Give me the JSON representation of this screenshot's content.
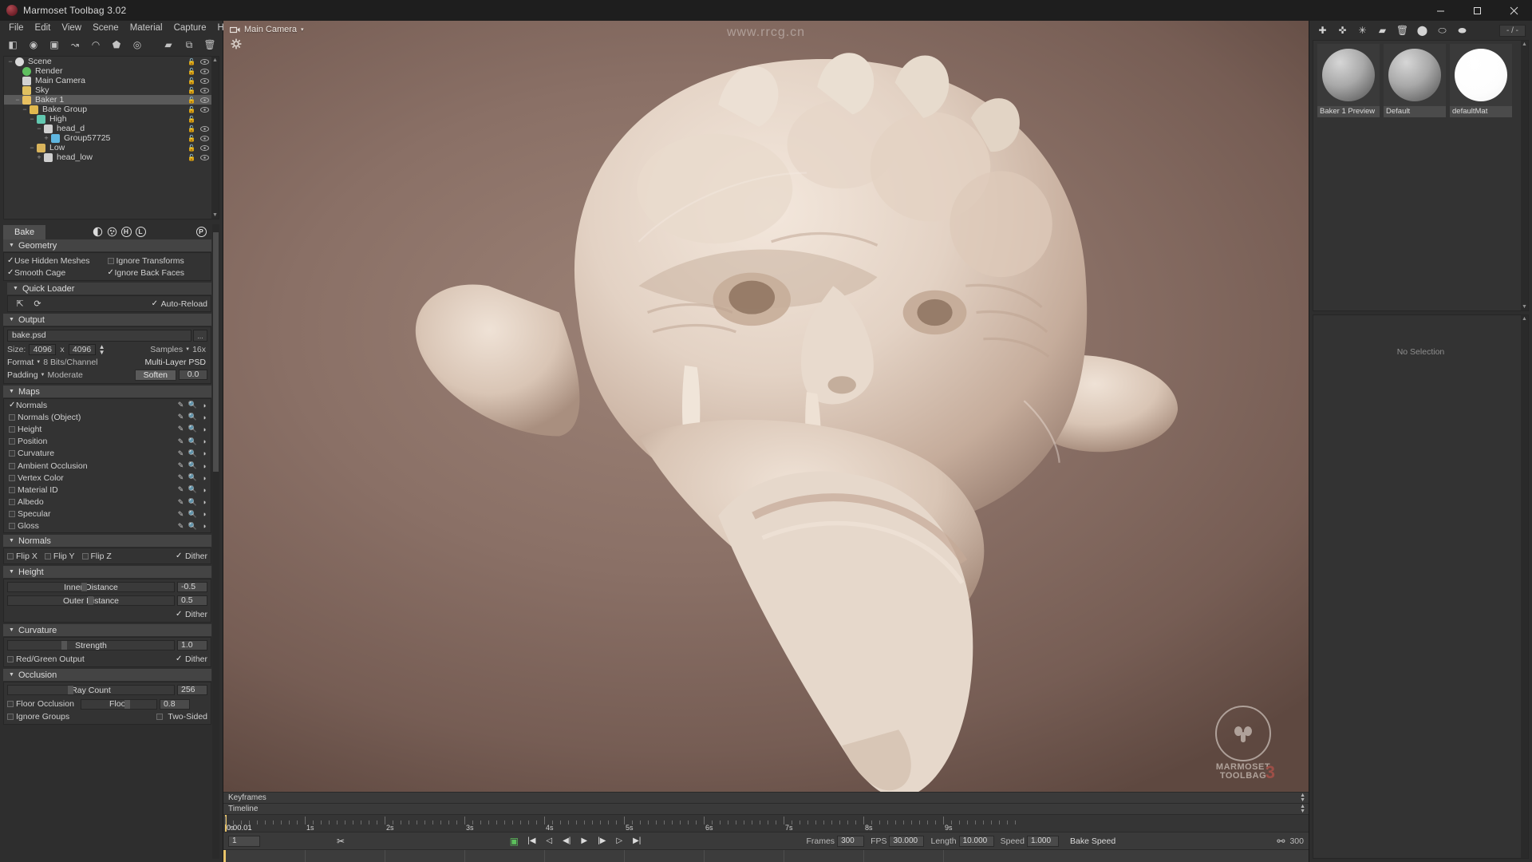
{
  "window": {
    "title": "Marmoset Toolbag 3.02",
    "app_icon": "marmoset-logo-icon",
    "controls": {
      "minimize": "minimize-icon",
      "maximize": "maximize-icon",
      "close": "close-icon"
    }
  },
  "menubar": {
    "items": [
      "File",
      "Edit",
      "View",
      "Scene",
      "Material",
      "Capture",
      "Help"
    ]
  },
  "left_toolbar": {
    "buttons": [
      {
        "name": "add-mesh-icon",
        "glyph": "◧"
      },
      {
        "name": "add-light-icon",
        "glyph": "◉"
      },
      {
        "name": "add-camera-icon",
        "glyph": "▣"
      },
      {
        "name": "add-turntable-icon",
        "glyph": "↝"
      },
      {
        "name": "add-sky-icon",
        "glyph": "◠"
      },
      {
        "name": "add-baker-icon",
        "glyph": "⬟"
      },
      {
        "name": "add-fog-icon",
        "glyph": "◎"
      },
      {
        "name": "folder-icon",
        "glyph": "▰"
      },
      {
        "name": "duplicate-icon",
        "glyph": "⧉"
      },
      {
        "name": "delete-icon",
        "glyph": "🗑"
      }
    ]
  },
  "scene_tree": {
    "nodes": [
      {
        "label": "Scene",
        "depth": 0,
        "icon": "scene-icon",
        "expander": "−",
        "lock": true,
        "eye": true,
        "selected": false
      },
      {
        "label": "Render",
        "depth": 1,
        "icon": "render-icon",
        "expander": "",
        "lock": true,
        "eye": true,
        "selected": false
      },
      {
        "label": "Main Camera",
        "depth": 1,
        "icon": "camera-icon",
        "expander": "",
        "lock": true,
        "eye": true,
        "selected": false
      },
      {
        "label": "Sky",
        "depth": 1,
        "icon": "sky-icon",
        "expander": "",
        "lock": true,
        "eye": true,
        "selected": false
      },
      {
        "label": "Baker 1",
        "depth": 1,
        "icon": "baker-icon",
        "expander": "−",
        "lock": true,
        "eye": true,
        "selected": true
      },
      {
        "label": "Bake Group",
        "depth": 2,
        "icon": "folder-icon",
        "expander": "−",
        "lock": true,
        "eye": true,
        "selected": false
      },
      {
        "label": "High",
        "depth": 3,
        "icon": "high-icon",
        "expander": "−",
        "lock": true,
        "eye": false,
        "selected": false
      },
      {
        "label": "head_d",
        "depth": 4,
        "icon": "mesh-icon",
        "expander": "−",
        "lock": true,
        "eye": true,
        "selected": false
      },
      {
        "label": "Group57725",
        "depth": 5,
        "icon": "group-icon",
        "expander": "+",
        "lock": true,
        "eye": true,
        "selected": false
      },
      {
        "label": "Low",
        "depth": 3,
        "icon": "low-icon",
        "expander": "−",
        "lock": true,
        "eye": true,
        "selected": false
      },
      {
        "label": "head_low",
        "depth": 4,
        "icon": "mesh-icon",
        "expander": "+",
        "lock": true,
        "eye": true,
        "selected": false
      }
    ]
  },
  "bake_panel": {
    "tab_label": "Bake",
    "header_buttons": [
      {
        "name": "bake-preview-toggle-icon",
        "glyph": "◐"
      },
      {
        "name": "bake-samples-icon",
        "glyph": "✸"
      },
      {
        "name": "high-poly-toggle",
        "glyph": "H"
      },
      {
        "name": "low-poly-toggle",
        "glyph": "L"
      },
      {
        "name": "preview-toggle",
        "glyph": "P"
      }
    ],
    "geometry": {
      "title": "Geometry",
      "options": [
        {
          "label": "Use Hidden Meshes",
          "checked": true
        },
        {
          "label": "Ignore Transforms",
          "checked": false
        },
        {
          "label": "Smooth Cage",
          "checked": true
        },
        {
          "label": "Ignore Back Faces",
          "checked": true
        }
      ]
    },
    "quick_loader": {
      "title": "Quick Loader",
      "load_icon": "load-files-icon",
      "reload_icon": "reload-icon",
      "auto_reload": {
        "label": "Auto-Reload",
        "checked": true
      }
    },
    "output": {
      "title": "Output",
      "filename": "bake.psd",
      "browse_label": "...",
      "size_label": "Size:",
      "width": "4096",
      "x_label": "x",
      "height": "4096",
      "samples_label": "Samples",
      "samples_value": "16x",
      "format_label": "Format",
      "format_value": "8 Bits/Channel",
      "multi_layer_label": "Multi-Layer PSD",
      "padding_label": "Padding",
      "padding_value": "Moderate",
      "soften_label": "Soften",
      "soften_value": "0.0"
    },
    "maps": {
      "title": "Maps",
      "items": [
        {
          "label": "Normals",
          "checked": true
        },
        {
          "label": "Normals (Object)",
          "checked": false
        },
        {
          "label": "Height",
          "checked": false
        },
        {
          "label": "Position",
          "checked": false
        },
        {
          "label": "Curvature",
          "checked": false
        },
        {
          "label": "Ambient Occlusion",
          "checked": false
        },
        {
          "label": "Vertex Color",
          "checked": false
        },
        {
          "label": "Material ID",
          "checked": false
        },
        {
          "label": "Albedo",
          "checked": false
        },
        {
          "label": "Specular",
          "checked": false
        },
        {
          "label": "Gloss",
          "checked": false
        }
      ],
      "row_icons": [
        "edit-pencil-icon",
        "preview-magnifier-icon",
        "material-sphere-icon"
      ]
    },
    "normals": {
      "title": "Normals",
      "flip_x": {
        "label": "Flip X",
        "checked": false
      },
      "flip_y": {
        "label": "Flip Y",
        "checked": false
      },
      "flip_z": {
        "label": "Flip Z",
        "checked": false
      },
      "dither": {
        "label": "Dither",
        "checked": true
      }
    },
    "height": {
      "title": "Height",
      "inner_distance_label": "Inner Distance",
      "inner_distance_value": "-0.5",
      "outer_distance_label": "Outer Distance",
      "outer_distance_value": "0.5",
      "dither": {
        "label": "Dither",
        "checked": true
      }
    },
    "curvature": {
      "title": "Curvature",
      "strength_label": "Strength",
      "strength_value": "1.0",
      "red_green_output": {
        "label": "Red/Green Output",
        "checked": false
      },
      "dither": {
        "label": "Dither",
        "checked": true
      }
    },
    "occlusion": {
      "title": "Occlusion",
      "ray_count_label": "Ray Count",
      "ray_count_value": "256",
      "floor_occlusion": {
        "label": "Floor Occlusion",
        "checked": false
      },
      "floor_label": "Floor",
      "floor_value": "0.8",
      "ignore_groups": {
        "label": "Ignore Groups",
        "checked": false
      },
      "two_sided": {
        "label": "Two-Sided",
        "checked": false
      }
    }
  },
  "viewport": {
    "camera_label": "Main Camera",
    "camera_icon": "camera-icon",
    "camera_caret": "▾",
    "settings_icon": "gear-icon",
    "watermark": "www.rrcg.cn",
    "logo": {
      "line1": "MARMOSET",
      "line2": "TOOLBAG",
      "version": "3"
    }
  },
  "timeline": {
    "keyframes_label": "Keyframes",
    "timeline_label": "Timeline",
    "timecode": "0:00.01",
    "frame_field": "1",
    "ruler_labels": [
      "0s",
      "1s",
      "2s",
      "3s",
      "4s",
      "5s",
      "6s",
      "7s",
      "8s",
      "9s"
    ],
    "scissors_icon": "cut-keyframe-icon",
    "transport": [
      {
        "name": "record-button",
        "glyph": "▣"
      },
      {
        "name": "jump-start-button",
        "glyph": "|◀"
      },
      {
        "name": "prev-keyframe-button",
        "glyph": "◁"
      },
      {
        "name": "step-back-button",
        "glyph": "◀|"
      },
      {
        "name": "play-button",
        "glyph": "▶"
      },
      {
        "name": "step-forward-button",
        "glyph": "|▶"
      },
      {
        "name": "next-keyframe-button",
        "glyph": "▷"
      },
      {
        "name": "jump-end-button",
        "glyph": "▶|"
      }
    ],
    "frames_label": "Frames",
    "frames_value": "300",
    "fps_label": "FPS",
    "fps_value": "30.000",
    "length_label": "Length",
    "length_value": "10.000",
    "speed_label": "Speed",
    "speed_value": "1.000",
    "bake_speed_label": "Bake Speed",
    "link_icon": "link-icon",
    "end_frame_value": "300"
  },
  "right_panel": {
    "toolbar": [
      {
        "name": "add-material-icon",
        "glyph": "✚"
      },
      {
        "name": "duplicate-material-icon",
        "glyph": "✜"
      },
      {
        "name": "clear-material-icon",
        "glyph": "✳"
      },
      {
        "name": "folder-icon",
        "glyph": "▰"
      },
      {
        "name": "delete-material-icon",
        "glyph": "🗑"
      },
      {
        "name": "assign-material-icon",
        "glyph": "⬤"
      },
      {
        "name": "import-material-icon",
        "glyph": "⬭"
      },
      {
        "name": "export-material-icon",
        "glyph": "⬬"
      }
    ],
    "count_label": "- / -",
    "materials": [
      {
        "name": "Baker 1 Preview",
        "swatch": "gray-sphere"
      },
      {
        "name": "Default",
        "swatch": "gray-sphere"
      },
      {
        "name": "defaultMat",
        "swatch": "white-sphere"
      }
    ],
    "no_selection_label": "No Selection"
  },
  "colors": {
    "accent_playhead": "#e9c46a",
    "panel_bg": "#2e2e2e",
    "section_head": "#444444",
    "selection": "#5a5a5a",
    "viewport_bg": "#8a7066",
    "logo_red": "#d2554e"
  }
}
